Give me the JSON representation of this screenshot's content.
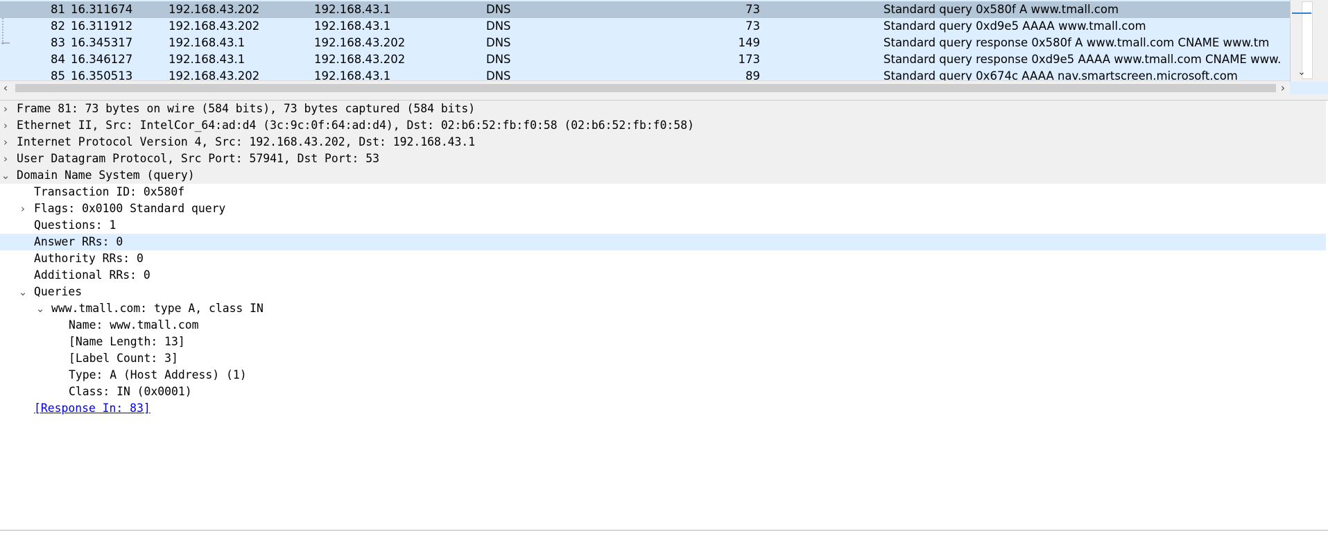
{
  "packet_list": {
    "rows": [
      {
        "no": "81",
        "time": "16.311674",
        "source": "192.168.43.202",
        "destination": "192.168.43.1",
        "protocol": "DNS",
        "length": "73",
        "info": "Standard query 0x580f A www.tmall.com"
      },
      {
        "no": "82",
        "time": "16.311912",
        "source": "192.168.43.202",
        "destination": "192.168.43.1",
        "protocol": "DNS",
        "length": "73",
        "info": "Standard query 0xd9e5 AAAA www.tmall.com"
      },
      {
        "no": "83",
        "time": "16.345317",
        "source": "192.168.43.1",
        "destination": "192.168.43.202",
        "protocol": "DNS",
        "length": "149",
        "info": "Standard query response 0x580f A www.tmall.com CNAME www.tm"
      },
      {
        "no": "84",
        "time": "16.346127",
        "source": "192.168.43.1",
        "destination": "192.168.43.202",
        "protocol": "DNS",
        "length": "173",
        "info": "Standard query response 0xd9e5 AAAA www.tmall.com CNAME www."
      },
      {
        "no": "85",
        "time": "16.350513",
        "source": "192.168.43.202",
        "destination": "192.168.43.1",
        "protocol": "DNS",
        "length": "89",
        "info": "Standard query 0x674c AAAA nav.smartscreen.microsoft.com"
      }
    ],
    "selected_row_index": 0
  },
  "details": {
    "lines": [
      "Frame 81: 73 bytes on wire (584 bits), 73 bytes captured (584 bits)",
      "Ethernet II, Src: IntelCor_64:ad:d4 (3c:9c:0f:64:ad:d4), Dst: 02:b6:52:fb:f0:58 (02:b6:52:fb:f0:58)",
      "Internet Protocol Version 4, Src: 192.168.43.202, Dst: 192.168.43.1",
      "User Datagram Protocol, Src Port: 57941, Dst Port: 53",
      "Domain Name System (query)",
      "Transaction ID: 0x580f",
      "Flags: 0x0100 Standard query",
      "Questions: 1",
      "Answer RRs: 0",
      "Authority RRs: 0",
      "Additional RRs: 0",
      "Queries",
      "www.tmall.com: type A, class IN",
      "Name: www.tmall.com",
      "[Name Length: 13]",
      "[Label Count: 3]",
      "Type: A (Host Address) (1)",
      "Class: IN (0x0001)",
      "[Response In: 83]"
    ]
  },
  "icons": {
    "collapsed": "chevron-right-icon",
    "expanded": "chevron-down-icon"
  },
  "colors": {
    "selected_row": "#b3c6d8",
    "row_background": "#dceeff",
    "link": "#0000ee"
  }
}
